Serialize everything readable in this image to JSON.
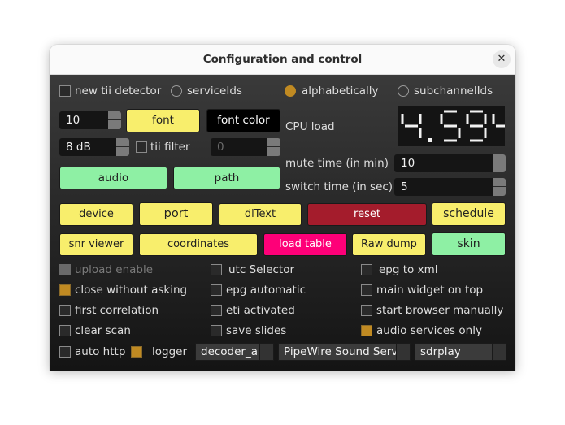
{
  "window": {
    "title": "Configuration and control",
    "close_icon": "close-x-icon"
  },
  "top_row": {
    "new_tii_detector": {
      "label": "new tii detector",
      "checked": false
    },
    "sort_options": [
      {
        "label": "serviceIds",
        "selected": false
      },
      {
        "label": "alphabetically",
        "selected": true
      },
      {
        "label": "subchannelIds",
        "selected": false
      }
    ]
  },
  "font_size": {
    "value": "10"
  },
  "font_button": {
    "label": "font"
  },
  "font_color_button": {
    "label": "font color"
  },
  "threshold": {
    "value": "8 dB"
  },
  "tii_filter": {
    "label": "tii filter",
    "checked": false
  },
  "tii_filter_value": {
    "value": "0"
  },
  "audio_button": {
    "label": "audio"
  },
  "path_button": {
    "label": "path"
  },
  "cpu_load": {
    "label": "CPU load",
    "value": "4.594"
  },
  "mute_time": {
    "label": "mute time (in min)",
    "value": "10"
  },
  "switch_time": {
    "label": "switch time (in sec)",
    "value": "5"
  },
  "buttons_row1": [
    {
      "label": "device"
    },
    {
      "label": "port"
    },
    {
      "label": "dlText"
    },
    {
      "label": "reset"
    },
    {
      "label": "schedule"
    }
  ],
  "buttons_row2": [
    {
      "label": "snr viewer"
    },
    {
      "label": "coordinates"
    },
    {
      "label": "load table"
    },
    {
      "label": "Raw dump"
    },
    {
      "label": "skin"
    }
  ],
  "checkboxes": {
    "col1": [
      {
        "label": "upload enable",
        "checked": false,
        "disabled": true
      },
      {
        "label": "close without asking",
        "checked": true
      },
      {
        "label": "first correlation",
        "checked": false
      },
      {
        "label": "clear scan",
        "checked": false
      }
    ],
    "col2": [
      {
        "label": "utc Selector",
        "checked": false
      },
      {
        "label": "epg automatic",
        "checked": false
      },
      {
        "label": "eti activated",
        "checked": false
      },
      {
        "label": "save slides",
        "checked": false
      }
    ],
    "col3": [
      {
        "label": "epg to xml",
        "checked": false
      },
      {
        "label": "main widget on top",
        "checked": false
      },
      {
        "label": "start browser manually",
        "checked": false
      },
      {
        "label": "audio services only",
        "checked": true
      }
    ]
  },
  "bottom_row": {
    "auto_http": {
      "label": "auto http",
      "checked": false
    },
    "logger": {
      "label": "logger",
      "checked": true
    },
    "decoder_select": {
      "value": "decoder_a"
    },
    "audio_output_select": {
      "value": "PipeWire Sound Serv"
    },
    "device_select": {
      "value": "sdrplay"
    }
  },
  "colors": {
    "accent": "#c08a22",
    "yellow_button": "#f8ee6c",
    "green_button": "#8ef0a4",
    "reset_button": "#a41c2c",
    "load_table_button": "#fe0078"
  }
}
